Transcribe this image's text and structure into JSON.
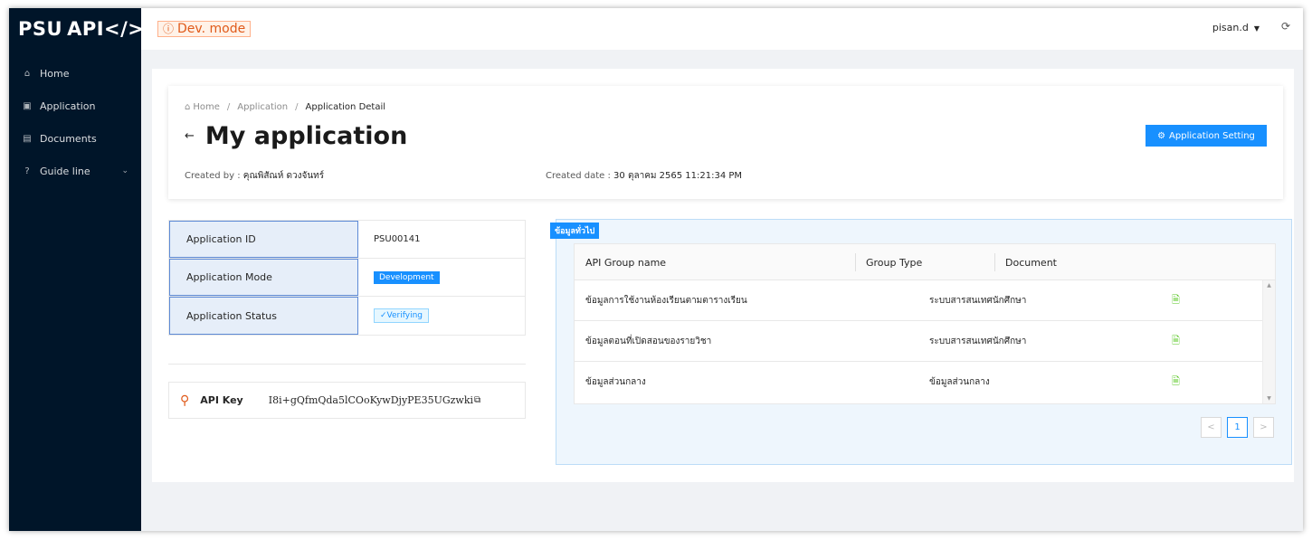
{
  "app": {
    "logo_prefix": "PSU",
    "logo_suffix": "API</>",
    "dev_mode_label": "Dev. mode"
  },
  "sidebar": {
    "items": [
      {
        "label": "Home",
        "icon": "home-icon"
      },
      {
        "label": "Application",
        "icon": "application-icon"
      },
      {
        "label": "Documents",
        "icon": "document-icon"
      },
      {
        "label": "Guide line",
        "icon": "question-circle-icon",
        "expandable": true
      }
    ]
  },
  "header": {
    "username": "pisan.d",
    "logout_icon": "logout-icon"
  },
  "breadcrumb": {
    "items": [
      "Home",
      "Application",
      "Application Detail"
    ]
  },
  "page": {
    "title": "My application",
    "setting_button": "Application Setting",
    "created_by_label": "Created by :",
    "created_by_value": "คุณพิสัณห์ ดวงจันทร์",
    "created_date_label": "Created date :",
    "created_date_value": "30 ตุลาคม 2565 11:21:34 PM"
  },
  "info": {
    "rows": [
      {
        "label": "Application ID",
        "value": "PSU00141"
      },
      {
        "label": "Application Mode",
        "value": "Development"
      },
      {
        "label": "Application Status",
        "value": "Verifying"
      }
    ]
  },
  "api_key": {
    "label": "API Key",
    "value": "I8i+gQfmQda5lCOoKywDjyPE35UGzwki"
  },
  "general": {
    "ribbon": "ข้อมูลทั่วไป",
    "columns": [
      "API Group name",
      "Group Type",
      "Document"
    ],
    "rows": [
      {
        "name": "ข้อมูลการใช้งานห้องเรียนตามตารางเรียน",
        "type": "ระบบสารสนเทศนักศึกษา"
      },
      {
        "name": "ข้อมูลตอนที่เปิดสอนของรายวิชา",
        "type": "ระบบสารสนเทศนักศึกษา"
      },
      {
        "name": "ข้อมูลส่วนกลาง",
        "type": "ข้อมูลส่วนกลาง"
      }
    ],
    "pager": {
      "prev": "<",
      "current": "1",
      "next": ">"
    }
  },
  "colors": {
    "sidebar_bg": "#001529",
    "primary": "#1890ff",
    "dev_mode": "#e05a1a",
    "doc_icon": "#52c41a"
  }
}
